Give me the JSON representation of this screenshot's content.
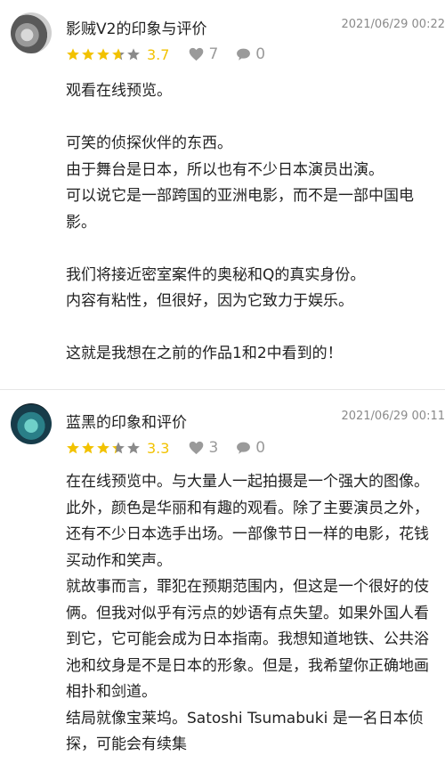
{
  "reviews": [
    {
      "name": "影贼V2的印象与评价",
      "date": "2021/06/29 00:22",
      "rating": "3.7",
      "rating_value": 3.7,
      "likes": "7",
      "comments": "0",
      "paragraphs": [
        "观看在线预览。",
        "",
        "可笑的侦探伙伴的东西。",
        "由于舞台是日本，所以也有不少日本演员出演。",
        "可以说它是一部跨国的亚洲电影，而不是一部中国电影。",
        "",
        "我们将接近密室案件的奥秘和Q的真实身份。",
        "内容有粘性，但很好，因为它致力于娱乐。",
        "",
        "这就是我想在之前的作品1和2中看到的！"
      ]
    },
    {
      "name": "蓝黑的印象和评价",
      "date": "2021/06/29 00:11",
      "rating": "3.3",
      "rating_value": 3.3,
      "likes": "3",
      "comments": "0",
      "paragraphs": [
        "在在线预览中。与大量人一起拍摄是一个强大的图像。此外，颜色是华丽和有趣的观看。除了主要演员之外，还有不少日本选手出场。一部像节日一样的电影，花钱买动作和笑声。",
        "就故事而言，罪犯在预期范围内，但这是一个很好的伎俩。但我对似乎有污点的妙语有点失望。如果外国人看到它，它可能会成为日本指南。我想知道地铁、公共浴池和纹身是不是日本的形象。但是，我希望你正确地画相扑和剑道。",
        "结局就像宝莱坞。Satoshi Tsumabuki 是一名日本侦探，可能会有续集"
      ]
    }
  ],
  "colors": {
    "star_filled": "#f2c200",
    "star_empty": "#8a8a8a",
    "muted": "#9a9a9a"
  },
  "icons": {
    "like": "heart-icon",
    "comment": "comment-bubble-icon"
  }
}
